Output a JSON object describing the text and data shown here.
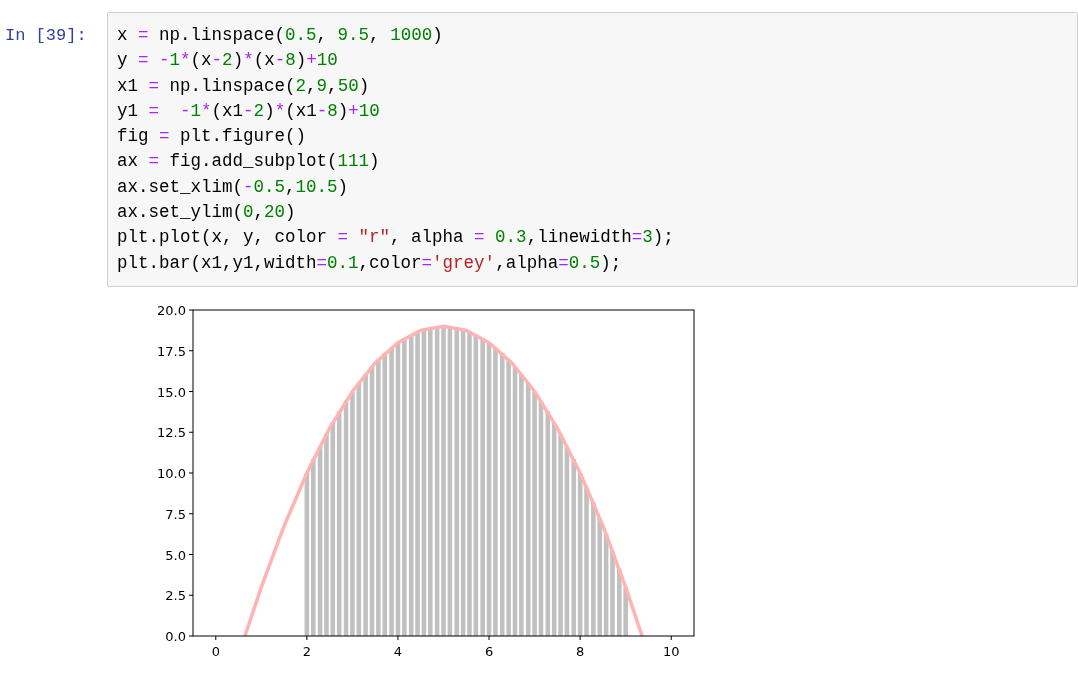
{
  "cell": {
    "prompt": "In [39]:",
    "code_lines": [
      [
        {
          "text": "x ",
          "kind": "plain"
        },
        {
          "text": "=",
          "kind": "op"
        },
        {
          "text": " np.linspace(",
          "kind": "plain"
        },
        {
          "text": "0.5",
          "kind": "num"
        },
        {
          "text": ", ",
          "kind": "plain"
        },
        {
          "text": "9.5",
          "kind": "num"
        },
        {
          "text": ", ",
          "kind": "plain"
        },
        {
          "text": "1000",
          "kind": "num"
        },
        {
          "text": ")",
          "kind": "plain"
        }
      ],
      [
        {
          "text": "y ",
          "kind": "plain"
        },
        {
          "text": "= ",
          "kind": "op"
        },
        {
          "text": "-",
          "kind": "op"
        },
        {
          "text": "1",
          "kind": "num"
        },
        {
          "text": "*",
          "kind": "op"
        },
        {
          "text": "(x",
          "kind": "plain"
        },
        {
          "text": "-",
          "kind": "op"
        },
        {
          "text": "2",
          "kind": "num"
        },
        {
          "text": ")",
          "kind": "plain"
        },
        {
          "text": "*",
          "kind": "op"
        },
        {
          "text": "(x",
          "kind": "plain"
        },
        {
          "text": "-",
          "kind": "op"
        },
        {
          "text": "8",
          "kind": "num"
        },
        {
          "text": ")",
          "kind": "plain"
        },
        {
          "text": "+",
          "kind": "op"
        },
        {
          "text": "10",
          "kind": "num"
        }
      ],
      [
        {
          "text": "x1 ",
          "kind": "plain"
        },
        {
          "text": "=",
          "kind": "op"
        },
        {
          "text": " np.linspace(",
          "kind": "plain"
        },
        {
          "text": "2",
          "kind": "num"
        },
        {
          "text": ",",
          "kind": "plain"
        },
        {
          "text": "9",
          "kind": "num"
        },
        {
          "text": ",",
          "kind": "plain"
        },
        {
          "text": "50",
          "kind": "num"
        },
        {
          "text": ")",
          "kind": "plain"
        }
      ],
      [
        {
          "text": "y1 ",
          "kind": "plain"
        },
        {
          "text": "=  ",
          "kind": "op"
        },
        {
          "text": "-",
          "kind": "op"
        },
        {
          "text": "1",
          "kind": "num"
        },
        {
          "text": "*",
          "kind": "op"
        },
        {
          "text": "(x1",
          "kind": "plain"
        },
        {
          "text": "-",
          "kind": "op"
        },
        {
          "text": "2",
          "kind": "num"
        },
        {
          "text": ")",
          "kind": "plain"
        },
        {
          "text": "*",
          "kind": "op"
        },
        {
          "text": "(x1",
          "kind": "plain"
        },
        {
          "text": "-",
          "kind": "op"
        },
        {
          "text": "8",
          "kind": "num"
        },
        {
          "text": ")",
          "kind": "plain"
        },
        {
          "text": "+",
          "kind": "op"
        },
        {
          "text": "10",
          "kind": "num"
        }
      ],
      [
        {
          "text": "fig ",
          "kind": "plain"
        },
        {
          "text": "=",
          "kind": "op"
        },
        {
          "text": " plt.figure()",
          "kind": "plain"
        }
      ],
      [
        {
          "text": "ax ",
          "kind": "plain"
        },
        {
          "text": "=",
          "kind": "op"
        },
        {
          "text": " fig.add_subplot(",
          "kind": "plain"
        },
        {
          "text": "111",
          "kind": "num"
        },
        {
          "text": ")",
          "kind": "plain"
        }
      ],
      [
        {
          "text": "ax.set_xlim(",
          "kind": "plain"
        },
        {
          "text": "-",
          "kind": "op"
        },
        {
          "text": "0.5",
          "kind": "num"
        },
        {
          "text": ",",
          "kind": "plain"
        },
        {
          "text": "10.5",
          "kind": "num"
        },
        {
          "text": ")",
          "kind": "plain"
        }
      ],
      [
        {
          "text": "ax.set_ylim(",
          "kind": "plain"
        },
        {
          "text": "0",
          "kind": "num"
        },
        {
          "text": ",",
          "kind": "plain"
        },
        {
          "text": "20",
          "kind": "num"
        },
        {
          "text": ")",
          "kind": "plain"
        }
      ],
      [
        {
          "text": "plt.plot(x, y, color ",
          "kind": "plain"
        },
        {
          "text": "= ",
          "kind": "op"
        },
        {
          "text": "\"r\"",
          "kind": "str"
        },
        {
          "text": ", alpha ",
          "kind": "plain"
        },
        {
          "text": "= ",
          "kind": "op"
        },
        {
          "text": "0.3",
          "kind": "num"
        },
        {
          "text": ",linewidth",
          "kind": "plain"
        },
        {
          "text": "=",
          "kind": "op"
        },
        {
          "text": "3",
          "kind": "num"
        },
        {
          "text": ");",
          "kind": "plain"
        }
      ],
      [
        {
          "text": "plt.bar(x1,y1,width",
          "kind": "plain"
        },
        {
          "text": "=",
          "kind": "op"
        },
        {
          "text": "0.1",
          "kind": "num"
        },
        {
          "text": ",color",
          "kind": "plain"
        },
        {
          "text": "=",
          "kind": "op"
        },
        {
          "text": "'grey'",
          "kind": "str"
        },
        {
          "text": ",alpha",
          "kind": "plain"
        },
        {
          "text": "=",
          "kind": "op"
        },
        {
          "text": "0.5",
          "kind": "num"
        },
        {
          "text": ");",
          "kind": "plain"
        }
      ]
    ]
  },
  "output": {
    "chart_data": {
      "type": "bar",
      "xlim": [
        -0.5,
        10.5
      ],
      "ylim": [
        0,
        20
      ],
      "xticks": [
        0,
        2,
        4,
        6,
        8,
        10
      ],
      "yticks": [
        {
          "value": 0,
          "label": "0.0"
        },
        {
          "value": 2.5,
          "label": "2.5"
        },
        {
          "value": 5,
          "label": "5.0"
        },
        {
          "value": 7.5,
          "label": "7.5"
        },
        {
          "value": 10,
          "label": "10.0"
        },
        {
          "value": 12.5,
          "label": "12.5"
        },
        {
          "value": 15,
          "label": "15.0"
        },
        {
          "value": 17.5,
          "label": "17.5"
        },
        {
          "value": 20,
          "label": "20.0"
        }
      ],
      "series": [
        {
          "color": "#c0c0c0",
          "x": [
            2,
            2.14,
            2.29,
            2.43,
            2.57,
            2.71,
            2.86,
            3,
            3.14,
            3.29,
            3.43,
            3.57,
            3.71,
            3.86,
            4,
            4.14,
            4.29,
            4.43,
            4.57,
            4.71,
            4.86,
            5,
            5.14,
            5.29,
            5.43,
            5.57,
            5.71,
            5.86,
            6,
            6.14,
            6.29,
            6.43,
            6.57,
            6.71,
            6.86,
            7,
            7.14,
            7.29,
            7.43,
            7.57,
            7.71,
            7.86,
            8,
            8.14,
            8.29,
            8.43,
            8.57,
            8.71,
            8.86,
            9
          ],
          "values": [
            10,
            10.84,
            11.63,
            12.39,
            13.1,
            13.78,
            14.41,
            15,
            15.55,
            16.06,
            16.53,
            16.96,
            17.35,
            17.69,
            18,
            18.27,
            18.49,
            18.67,
            18.82,
            18.92,
            18.98,
            19,
            18.98,
            18.92,
            18.82,
            18.67,
            18.49,
            18.27,
            18,
            17.69,
            17.35,
            16.96,
            16.53,
            16.06,
            15.55,
            15,
            14.41,
            13.78,
            13.1,
            12.39,
            11.63,
            10.84,
            10,
            9.12,
            8.2,
            7.24,
            6.24,
            5.2,
            4.12,
            3
          ]
        },
        {
          "type": "line",
          "color": "#ffb3b3",
          "x": [
            0.64,
            1,
            1.5,
            2,
            2.5,
            3,
            3.5,
            4,
            4.5,
            5,
            5.5,
            6,
            6.5,
            7,
            7.5,
            8,
            8.5,
            9,
            9.36
          ],
          "values": [
            0,
            3,
            6.75,
            10,
            12.75,
            15,
            16.75,
            18,
            18.75,
            19,
            18.75,
            18,
            16.75,
            15,
            12.75,
            10,
            6.75,
            3,
            0
          ]
        }
      ]
    }
  }
}
